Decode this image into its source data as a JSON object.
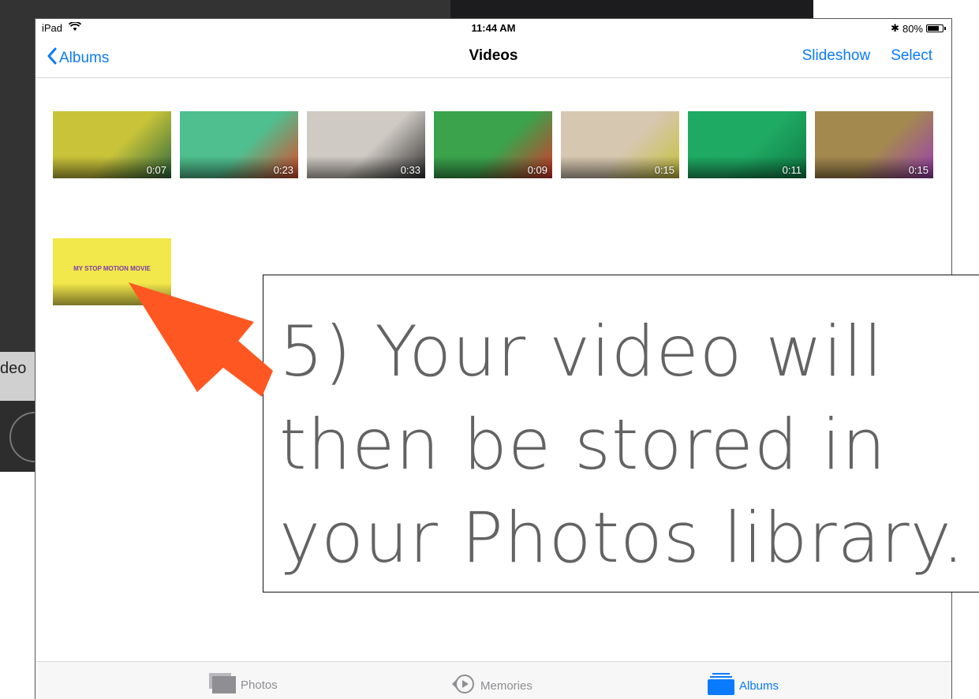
{
  "background": {
    "left_text": "deo"
  },
  "status_bar": {
    "device": "iPad",
    "time": "11:44 AM",
    "battery": "80%",
    "battery_level": 0.8
  },
  "nav": {
    "back_label": "Albums",
    "title": "Videos",
    "slideshow_label": "Slideshow",
    "select_label": "Select"
  },
  "videos": [
    {
      "duration": "0:07",
      "bg": "#c9c33a",
      "accent": "#2f6b3b"
    },
    {
      "duration": "0:23",
      "bg": "#4fbf8f",
      "accent": "#e04a2a"
    },
    {
      "duration": "0:33",
      "bg": "#cfcac3",
      "accent": "#333333"
    },
    {
      "duration": "0:09",
      "bg": "#3aa34c",
      "accent": "#d9372b"
    },
    {
      "duration": "0:15",
      "bg": "#d6c7b0",
      "accent": "#c8c23a"
    },
    {
      "duration": "0:11",
      "bg": "#1faa63",
      "accent": "#0f7d45"
    },
    {
      "duration": "0:15",
      "bg": "#a4894f",
      "accent": "#9b3fb0"
    }
  ],
  "movie": {
    "title": "MY STOP MOTION MOVIE",
    "bg": "#f2e74b"
  },
  "tabs": {
    "photos": "Photos",
    "memories": "Memories",
    "albums": "Albums"
  },
  "callout": {
    "text": "5) Your video will then be stored in your Photos library."
  },
  "colors": {
    "accent": "#0a7aff",
    "arrow": "#ff5722",
    "callout_text": "#636363"
  }
}
